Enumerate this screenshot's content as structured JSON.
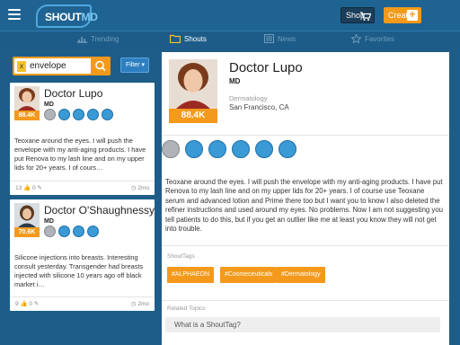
{
  "header": {
    "logo_prefix": "SHOUT",
    "logo_suffix": "MD",
    "shop_label": "Shop",
    "create_label": "Create",
    "create_plus": "+"
  },
  "tabs": [
    {
      "label": "Trending",
      "icon": "chart-icon",
      "active": false
    },
    {
      "label": "Shouts",
      "icon": "folder-icon",
      "active": true
    },
    {
      "label": "News",
      "icon": "news-icon",
      "active": false
    },
    {
      "label": "Favorites",
      "icon": "star-icon",
      "active": false
    }
  ],
  "search": {
    "clear_glyph": "x",
    "value": "envelope",
    "filter_label": "Filter",
    "filter_caret": "▾"
  },
  "cards": [
    {
      "name": "Doctor Lupo",
      "title": "MD",
      "score": "88.4K",
      "body": "Teoxane around the eyes. I will push the envelope with my anti-aging products. I have put Renova to my lash line and on my upper lids for 20+ years. I of cours…",
      "likes": "13",
      "comments": "0",
      "time": "2mo"
    },
    {
      "name": "Doctor O'Shaughnessy",
      "title": "MD",
      "score": "70.6K",
      "body": "Silicone injections into breasts. Interesting consult yesterday. Transgender had breasts injected with silicone 10 years ago off black market i…",
      "likes": "9",
      "comments": "0",
      "time": "2mo"
    }
  ],
  "detail": {
    "name": "Doctor Lupo",
    "title": "MD",
    "score": "88.4K",
    "specialty": "Dermatology",
    "location": "San Francisco, CA",
    "body": "Teoxane around the eyes. I will push the envelope with my anti-aging products. I have put Renova to my lash line and on my upper lids for 20+ years. I of course use Teoxane serum and advanced lotion and Prime there too but I want you to know I also deleted the refiner instructions and used around my eyes. No problems. Now I am not suggesting you tell patients to do this, but if you get an outlier like me at least you know they will not get into trouble.",
    "tags_label": "ShoutTags",
    "tags": [
      "#ALPHAEON",
      "#Cosmeceuticals",
      "#Dermatology"
    ],
    "related_label": "Related Topics",
    "topic_placeholder": "What is a ShoutTag?"
  },
  "colors": {
    "header_bg": "#1f6392",
    "accent": "#f39a1d",
    "badge_blue": "#3a9ad6"
  }
}
